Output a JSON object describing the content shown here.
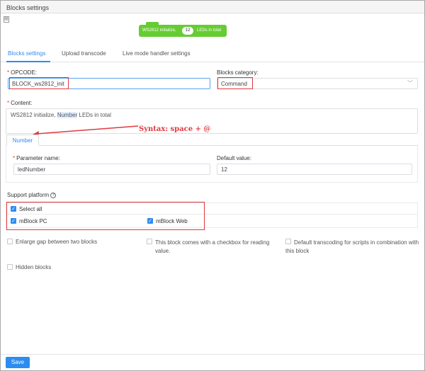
{
  "window": {
    "title": "Blocks settings"
  },
  "preview": {
    "text_before": "WS2812 initialize,",
    "param_value": "12",
    "text_after": "LEDs in total",
    "color": "#66cc33"
  },
  "tabs": [
    {
      "label": "Blocks settings",
      "active": true
    },
    {
      "label": "Upload transcode",
      "active": false
    },
    {
      "label": "Live mode handler settings",
      "active": false
    }
  ],
  "form": {
    "opcode": {
      "label": "OPCODE:",
      "value": "BLOCK_ws2812_init"
    },
    "category": {
      "label": "Blocks category:",
      "value": "Command"
    },
    "content": {
      "label": "Content:",
      "text_before": "WS2812 initialize, ",
      "highlight": "Number",
      "text_after": " LEDs in total"
    },
    "annotation": "Syntax: space + @",
    "param_tab": "Number",
    "param_name": {
      "label": "Parameter name:",
      "value": "ledNumber"
    },
    "default_value": {
      "label": "Default value:",
      "value": "12"
    },
    "support_platform": {
      "label": "Support platform",
      "select_all": "Select all",
      "options": [
        {
          "label": "mBlock PC",
          "checked": true
        },
        {
          "label": "mBlock Web",
          "checked": true
        }
      ]
    },
    "options": {
      "enlarge_gap": "Enlarge gap between two blocks",
      "checkbox_reading": "This block comes with a checkbox for reading value.",
      "default_transcoding": "Default transcoding for scripts in combination with this block",
      "hidden_blocks": "Hidden blocks"
    }
  },
  "footer": {
    "save_label": "Save"
  },
  "colors": {
    "accent": "#2d8cf0",
    "annotation": "#e0393e"
  }
}
